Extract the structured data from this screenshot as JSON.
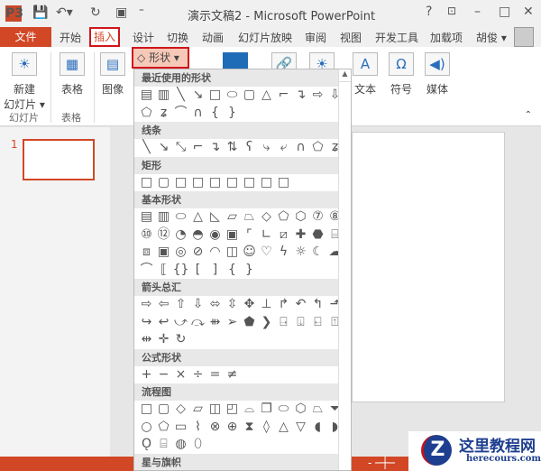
{
  "titlebar": {
    "app_icon": "P3",
    "title": "演示文稿2 - Microsoft PowerPoint",
    "help": "?",
    "minimize": "–",
    "maximize": "□",
    "close": "✕"
  },
  "tabs": {
    "file": "文件",
    "items": [
      "开始",
      "插入",
      "设计",
      "切换",
      "动画",
      "幻灯片放映",
      "审阅",
      "视图",
      "开发工具",
      "加载项"
    ],
    "user": "胡俊 ▾"
  },
  "ribbon": {
    "new_slide": "新建\n幻灯片 ▾",
    "table": "表格",
    "image": "图像",
    "shapes": "形状 ▾",
    "text": "文本",
    "symbol": "符号",
    "media": "媒体",
    "group_slides": "幻灯片",
    "group_tables": "表格"
  },
  "slides": {
    "number": "1"
  },
  "dropdown": {
    "sections": [
      {
        "title": "最近使用的形状",
        "rows": [
          [
            "text-box",
            "vertical-text-box",
            "line",
            "arrow-line",
            "rectangle",
            "oval",
            "rounded-rectangle",
            "triangle",
            "elbow-connector",
            "elbow-arrow-connector",
            "right-arrow",
            "down-arrow"
          ],
          [
            "freeform",
            "scribble",
            "arc",
            "curve",
            "left-brace",
            "right-brace"
          ]
        ]
      },
      {
        "title": "线条",
        "rows": [
          [
            "line",
            "arrow-line",
            "double-arrow-line",
            "elbow-connector",
            "elbow-arrow-connector",
            "elbow-double-arrow",
            "curved-connector",
            "curved-arrow-connector",
            "curved-double-arrow",
            "curve",
            "freeform",
            "scribble"
          ]
        ]
      },
      {
        "title": "矩形",
        "rows": [
          [
            "rectangle",
            "rounded-rectangle",
            "snip-single-corner",
            "snip-same-side",
            "snip-diagonal",
            "snip-round",
            "round-single-corner",
            "round-same-side",
            "round-diagonal"
          ]
        ]
      },
      {
        "title": "基本形状",
        "rows": [
          [
            "text-box",
            "vertical-text-box",
            "oval",
            "triangle",
            "right-triangle",
            "parallelogram",
            "trapezoid",
            "diamond",
            "pentagon",
            "hexagon",
            "heptagon",
            "octagon"
          ],
          [
            "decagon",
            "dodecagon",
            "pie",
            "chord",
            "teardrop",
            "frame",
            "half-frame",
            "l-shape",
            "diagonal-stripe",
            "cross",
            "plaque",
            "can"
          ],
          [
            "cube",
            "bevel",
            "donut",
            "no-symbol",
            "block-arc",
            "folded-corner",
            "smiley",
            "heart",
            "lightning",
            "sun",
            "moon",
            "cloud"
          ],
          [
            "arc",
            "double-bracket",
            "double-brace",
            "left-bracket",
            "right-bracket",
            "left-brace",
            "right-brace"
          ]
        ]
      },
      {
        "title": "箭头总汇",
        "rows": [
          [
            "right-arrow",
            "left-arrow",
            "up-arrow",
            "down-arrow",
            "left-right-arrow",
            "up-down-arrow",
            "quad-arrow",
            "left-right-up-arrow",
            "bent-arrow",
            "u-turn-arrow",
            "left-up-arrow",
            "bent-up-arrow"
          ],
          [
            "curved-right-arrow",
            "curved-left-arrow",
            "curved-up-arrow",
            "curved-down-arrow",
            "striped-right-arrow",
            "notched-right-arrow",
            "pentagon-arrow",
            "chevron",
            "right-callout",
            "down-callout",
            "left-callout",
            "up-callout"
          ],
          [
            "left-right-callout",
            "quad-callout",
            "circular-arrow"
          ]
        ]
      },
      {
        "title": "公式形状",
        "rows": [
          [
            "plus",
            "minus",
            "multiply",
            "divide",
            "equal",
            "not-equal"
          ]
        ]
      },
      {
        "title": "流程图",
        "rows": [
          [
            "process",
            "alternate-process",
            "decision",
            "data",
            "predefined-process",
            "internal-storage",
            "document",
            "multidocument",
            "terminator",
            "preparation",
            "manual-input",
            "manual-operation"
          ],
          [
            "connector",
            "off-page-connector",
            "card",
            "punched-tape",
            "summing-junction",
            "or",
            "collate",
            "sort",
            "extract",
            "merge",
            "stored-data",
            "delay"
          ],
          [
            "sequential-storage",
            "magnetic-disk",
            "direct-access-storage",
            "display"
          ]
        ]
      },
      {
        "title": "星与旗帜",
        "rows": []
      }
    ]
  },
  "watermark": {
    "brand_cn": "这里教程网",
    "brand_en": "herecours.com",
    "logo_letter": "Z"
  }
}
